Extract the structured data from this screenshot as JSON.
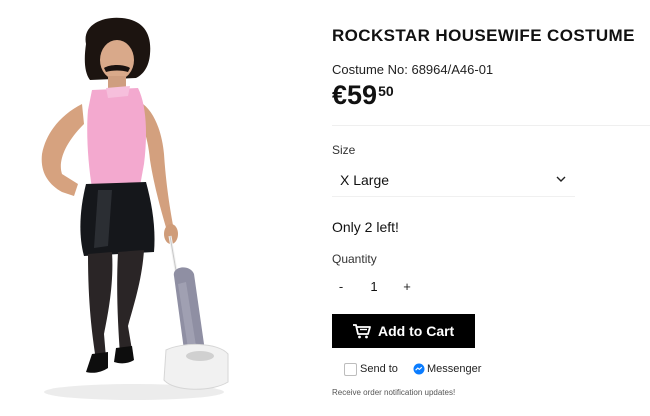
{
  "product": {
    "title": "ROCKSTAR HOUSEWIFE COSTUME",
    "costume_no": "Costume No: 68964/A46-01",
    "price_main": "€59",
    "price_cents": "50",
    "image_icon": "product-photo"
  },
  "size": {
    "label": "Size",
    "selected": "X Large",
    "icon": "chevron-down-icon"
  },
  "stock": {
    "text": "Only 2 left!"
  },
  "quantity": {
    "label": "Quantity",
    "value": "1",
    "minus": "-",
    "plus": "+"
  },
  "cart": {
    "label": "Add to Cart",
    "icon": "cart-icon"
  },
  "messenger": {
    "send_label": "Send to",
    "messenger_label": "Messenger",
    "checked": false
  },
  "notification": {
    "text": "Receive order notification updates!"
  },
  "colors": {
    "button_bg": "#000000",
    "messenger_blue": "#0a7cff",
    "top_pink": "#f3a9cf"
  }
}
